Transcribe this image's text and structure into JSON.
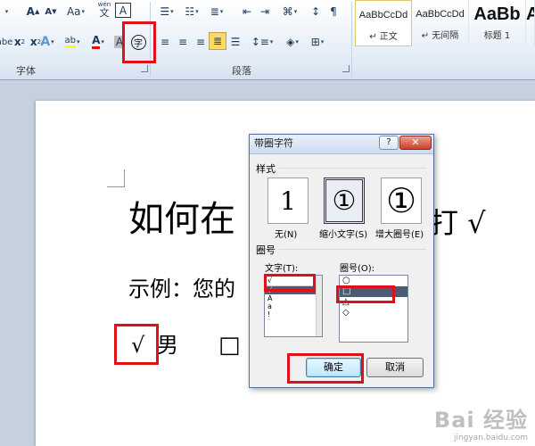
{
  "ribbon": {
    "row1": {
      "grow_font": "A",
      "shrink_font": "A",
      "change_case": "Aa",
      "phonetic_guide": "wén",
      "character_border": "A",
      "ascii_cmd": "⌘"
    },
    "row2": {
      "subscript": "x",
      "superscript": "x",
      "text_effect": "A",
      "highlight": "ab",
      "font_color": "A",
      "char_shading": "A",
      "enclose_characters": "字"
    },
    "groups": {
      "font": "字体",
      "paragraph": "段落"
    },
    "styles": [
      {
        "preview": "AaBbCcDd",
        "name": "↵ 正文"
      },
      {
        "preview": "AaBbCcDd",
        "name": "↵ 无间隔"
      },
      {
        "preview": "AaBb",
        "name": "标题 1"
      },
      {
        "preview": "A",
        "name": ""
      }
    ]
  },
  "document": {
    "heading_left": "如何在",
    "heading_right": "打 √",
    "example_line": "示例：您的",
    "checked_box": "√",
    "gender_male": "男",
    "unchecked_box": "□"
  },
  "dialog": {
    "title": "带圈字符",
    "help": "?",
    "close": "✕",
    "style_section": "样式",
    "style_options": [
      {
        "glyph": "1",
        "caption": "无(N)"
      },
      {
        "glyph": "①",
        "caption": "缩小文字(S)"
      },
      {
        "glyph": "①",
        "caption": "增大圈号(E)"
      }
    ],
    "enclosure_section": "圈号",
    "text_label": "文字(T):",
    "text_input_value": "√",
    "text_list": [
      "√",
      "A",
      "a",
      "!"
    ],
    "enclosure_label": "圈号(O):",
    "enclosure_list": [
      "○",
      "□",
      "△",
      "◇"
    ],
    "ok": "确定",
    "cancel": "取消"
  },
  "watermark": {
    "logo": "Bai 经验",
    "url": "jingyan.baidu.com"
  }
}
